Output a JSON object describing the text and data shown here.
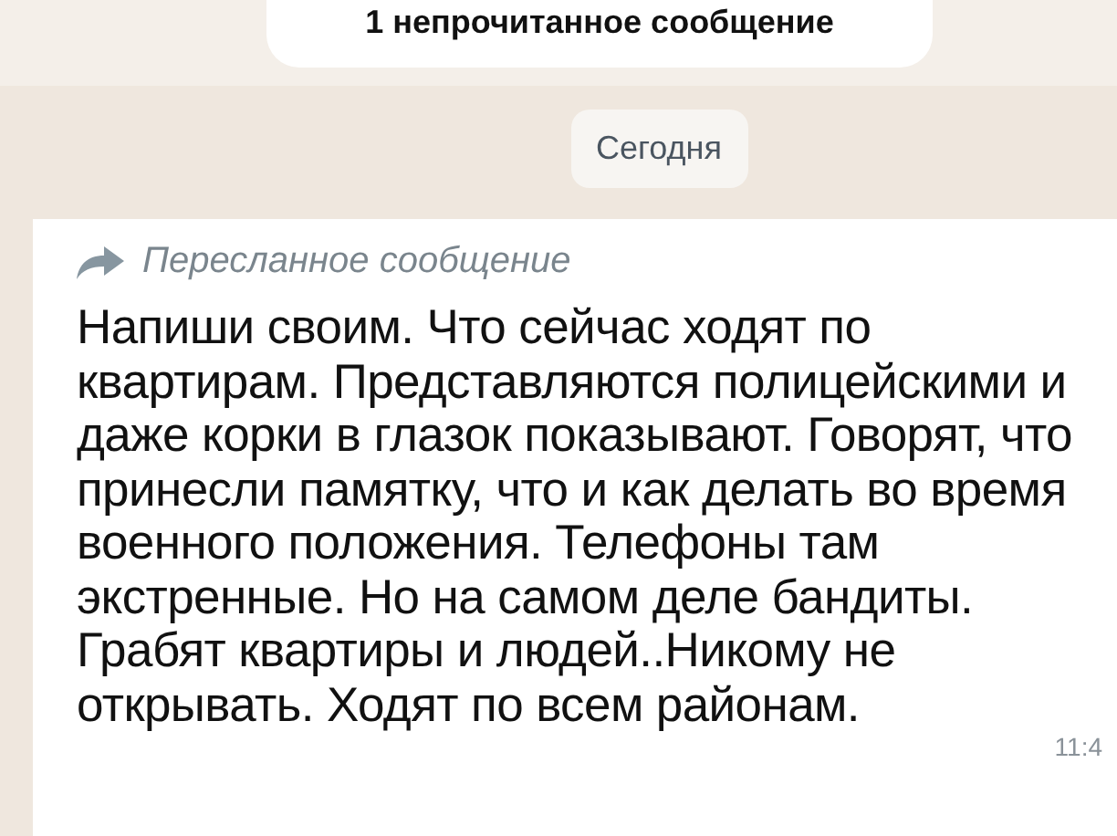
{
  "unread_banner": {
    "text": "1 непрочитанное сообщение"
  },
  "date_divider": {
    "text": "Сегодня"
  },
  "message": {
    "forwarded_label": "Пересланное сообщение",
    "text": "Напиши своим. Что сейчас ходят по квартирам. Представляются полицейскими и даже корки в глазок показывают. Говорят, что принесли памятку, что и как делать во время военного положения. Телефоны там экстренные. Но на самом деле бандиты. Грабят квартиры и людей..Никому не открывать. Ходят по всем районам.",
    "time": "11:4"
  }
}
